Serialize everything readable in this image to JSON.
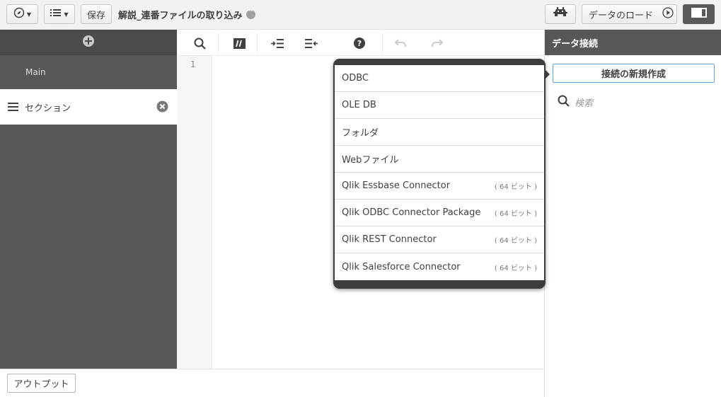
{
  "toolbar": {
    "save_label": "保存",
    "app_title": "解説_連番ファイルの取り込み",
    "load_label": "データのロード"
  },
  "left_panel": {
    "sections": [
      {
        "label": "Main"
      },
      {
        "label": "セクション"
      }
    ]
  },
  "editor": {
    "line_numbers": [
      "1"
    ]
  },
  "bottom": {
    "output_label": "アウトプット"
  },
  "right_panel": {
    "title": "データ接続",
    "create_label": "接続の新規作成",
    "search_placeholder": "検索"
  },
  "connection_menu": {
    "items": [
      {
        "label": "ODBC",
        "bits": ""
      },
      {
        "label": "OLE DB",
        "bits": ""
      },
      {
        "label": "フォルダ",
        "bits": ""
      },
      {
        "label": "Webファイル",
        "bits": ""
      },
      {
        "label": "Qlik Essbase Connector",
        "bits": "( 64 ビット )"
      },
      {
        "label": "Qlik ODBC Connector Package",
        "bits": "( 64 ビット )"
      },
      {
        "label": "Qlik REST Connector",
        "bits": "( 64 ビット )"
      },
      {
        "label": "Qlik Salesforce Connector",
        "bits": "( 64 ビット )"
      }
    ]
  },
  "colors": {
    "panel_dark": "#595754",
    "accent_border": "#6ba3d6",
    "popover_bg": "#3c3c3c"
  },
  "icons": [
    "compass-icon",
    "list-icon",
    "debug-icon",
    "play-icon",
    "view-toggle-icon",
    "add-icon",
    "hamburger-icon",
    "close-icon",
    "search-icon",
    "comment-icon",
    "indent-icon",
    "outdent-icon",
    "help-icon",
    "undo-icon",
    "redo-icon"
  ]
}
